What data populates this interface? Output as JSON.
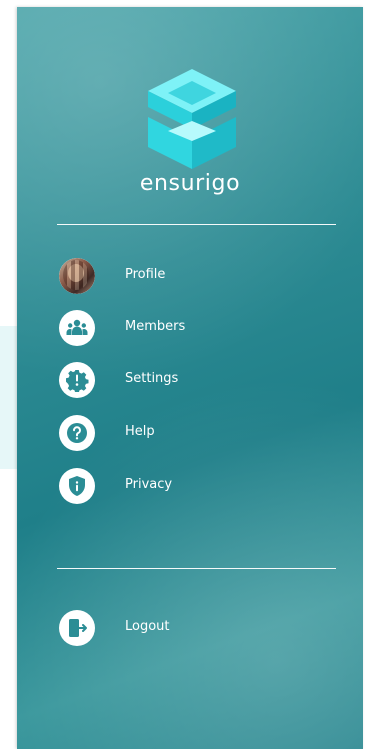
{
  "brand": {
    "name": "ensurigo"
  },
  "menu": {
    "items": [
      {
        "label": "Profile",
        "icon": "avatar"
      },
      {
        "label": "Members",
        "icon": "members-icon"
      },
      {
        "label": "Settings",
        "icon": "settings-icon"
      },
      {
        "label": "Help",
        "icon": "help-icon"
      },
      {
        "label": "Privacy",
        "icon": "privacy-icon"
      }
    ],
    "logout": {
      "label": "Logout",
      "icon": "logout-icon"
    }
  },
  "colors": {
    "drawer_teal": "#2e8c94",
    "icon_teal": "#2b8d95",
    "logo_cyan": "#38e0e8"
  }
}
